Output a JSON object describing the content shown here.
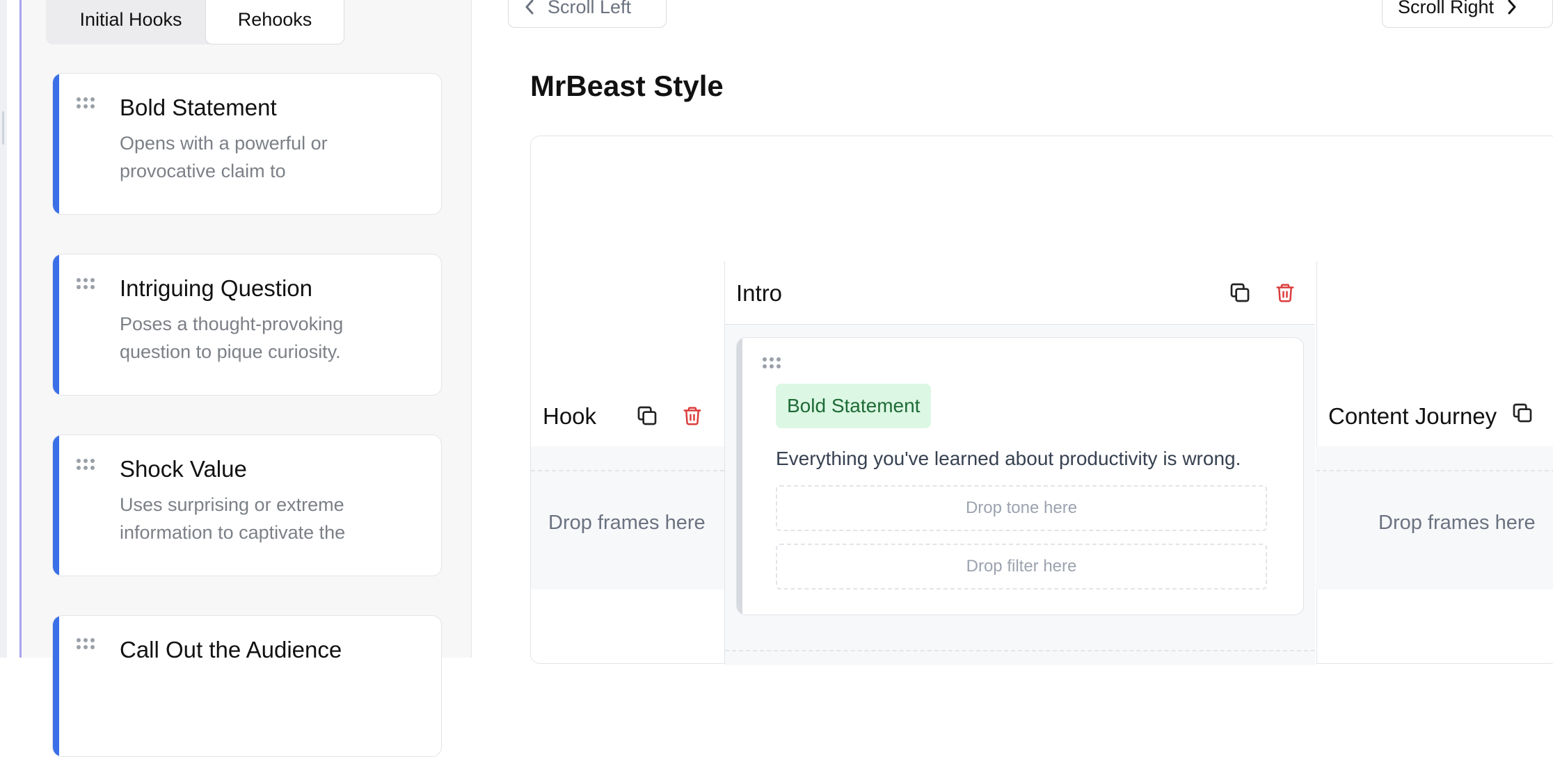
{
  "sidebar": {
    "tabs": [
      {
        "label": "Initial Hooks",
        "active": true
      },
      {
        "label": "Rehooks",
        "active": false
      }
    ],
    "cards": [
      {
        "title": "Bold Statement",
        "description": "Opens with a powerful or provocative claim to"
      },
      {
        "title": "Intriguing Question",
        "description": "Poses a thought-provoking question to pique curiosity."
      },
      {
        "title": "Shock Value",
        "description": "Uses surprising or extreme information to captivate the"
      },
      {
        "title": "Call Out the Audience",
        "description": ""
      }
    ]
  },
  "toolbar": {
    "scroll_left_label": "Scroll Left",
    "scroll_right_label": "Scroll Right"
  },
  "main": {
    "title": "MrBeast Style",
    "columns": [
      {
        "name": "Hook",
        "drop_label": "Drop frames here"
      },
      {
        "name": "Intro"
      },
      {
        "name": "Content Journey",
        "drop_label": "Drop frames here"
      }
    ],
    "intro_frame": {
      "badge": "Bold Statement",
      "text": "Everything you've learned about productivity is wrong.",
      "tone_placeholder": "Drop tone here",
      "filter_placeholder": "Drop filter here"
    }
  },
  "colors": {
    "accent_blue": "#3b6fe8",
    "delete_red": "#dc3c3c",
    "badge_green_bg": "#dcf7e3",
    "badge_green_text": "#1e6b36"
  },
  "icons": [
    "grip-icon",
    "copy-icon",
    "trash-icon",
    "chevron-left-icon",
    "chevron-right-icon"
  ]
}
